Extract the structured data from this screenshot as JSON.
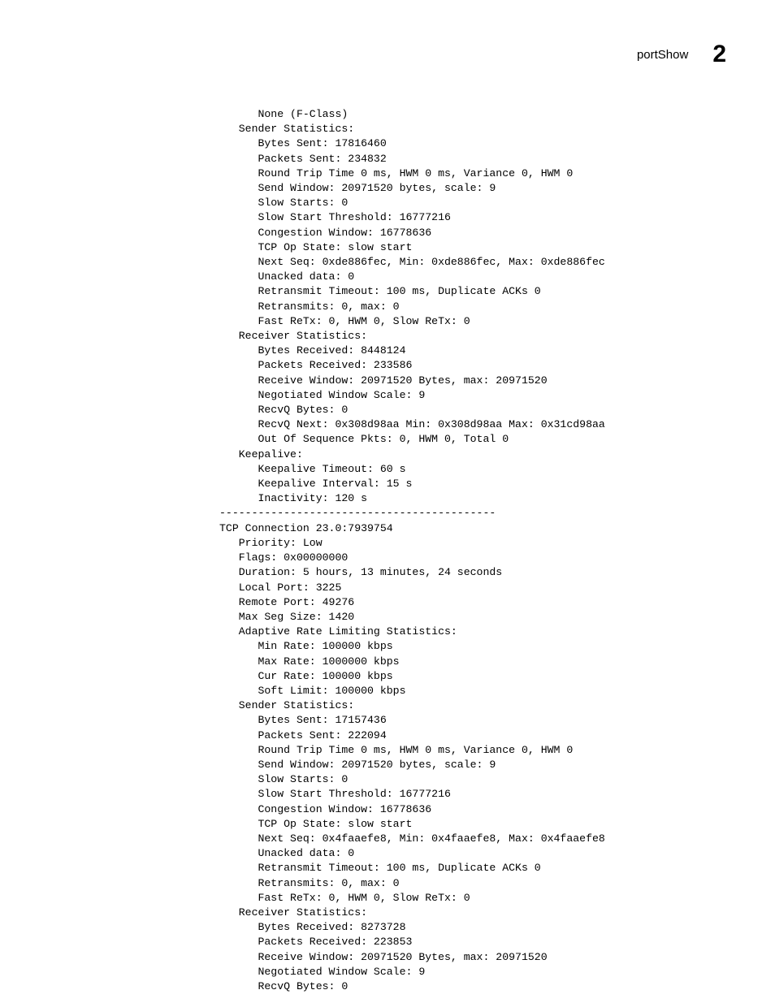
{
  "header": {
    "command": "portShow",
    "chapter": "2"
  },
  "indent": {
    "i3": "      ",
    "i2": "   ",
    "i1": ""
  },
  "lines": [
    "      None (F-Class)",
    "   Sender Statistics:",
    "      Bytes Sent: 17816460",
    "      Packets Sent: 234832",
    "      Round Trip Time 0 ms, HWM 0 ms, Variance 0, HWM 0",
    "      Send Window: 20971520 bytes, scale: 9",
    "      Slow Starts: 0",
    "      Slow Start Threshold: 16777216",
    "      Congestion Window: 16778636",
    "      TCP Op State: slow start",
    "      Next Seq: 0xde886fec, Min: 0xde886fec, Max: 0xde886fec",
    "      Unacked data: 0",
    "      Retransmit Timeout: 100 ms, Duplicate ACKs 0",
    "      Retransmits: 0, max: 0",
    "      Fast ReTx: 0, HWM 0, Slow ReTx: 0",
    "   Receiver Statistics:",
    "      Bytes Received: 8448124",
    "      Packets Received: 233586",
    "      Receive Window: 20971520 Bytes, max: 20971520",
    "      Negotiated Window Scale: 9",
    "      RecvQ Bytes: 0",
    "      RecvQ Next: 0x308d98aa Min: 0x308d98aa Max: 0x31cd98aa",
    "      Out Of Sequence Pkts: 0, HWM 0, Total 0",
    "   Keepalive:",
    "      Keepalive Timeout: 60 s",
    "      Keepalive Interval: 15 s",
    "      Inactivity: 120 s",
    "-------------------------------------------",
    "TCP Connection 23.0:7939754",
    "   Priority: Low",
    "   Flags: 0x00000000",
    "   Duration: 5 hours, 13 minutes, 24 seconds",
    "   Local Port: 3225",
    "   Remote Port: 49276",
    "   Max Seg Size: 1420",
    "   Adaptive Rate Limiting Statistics:",
    "      Min Rate: 100000 kbps",
    "      Max Rate: 1000000 kbps",
    "      Cur Rate: 100000 kbps",
    "      Soft Limit: 100000 kbps",
    "   Sender Statistics:",
    "      Bytes Sent: 17157436",
    "      Packets Sent: 222094",
    "      Round Trip Time 0 ms, HWM 0 ms, Variance 0, HWM 0",
    "      Send Window: 20971520 bytes, scale: 9",
    "      Slow Starts: 0",
    "      Slow Start Threshold: 16777216",
    "      Congestion Window: 16778636",
    "      TCP Op State: slow start",
    "      Next Seq: 0x4faaefe8, Min: 0x4faaefe8, Max: 0x4faaefe8",
    "      Unacked data: 0",
    "      Retransmit Timeout: 100 ms, Duplicate ACKs 0",
    "      Retransmits: 0, max: 0",
    "      Fast ReTx: 0, HWM 0, Slow ReTx: 0",
    "   Receiver Statistics:",
    "      Bytes Received: 8273728",
    "      Packets Received: 223853",
    "      Receive Window: 20971520 Bytes, max: 20971520",
    "      Negotiated Window Scale: 9",
    "      RecvQ Bytes: 0"
  ]
}
